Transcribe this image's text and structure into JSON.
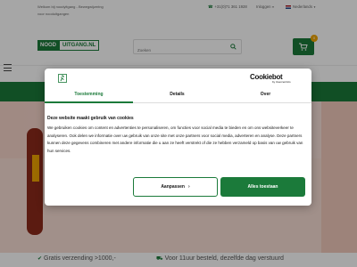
{
  "topbar": {
    "welcome": "Welkom bij noodуitgang - Bewegwijzering voor nooduitgangen",
    "phone": "+31(0)71 361 1928",
    "login": "Inloggen",
    "language": "Nederlands"
  },
  "header": {
    "logo_part1": "NOOD",
    "logo_part2": "UITGANG.NL",
    "search_placeholder": "Zoeken",
    "cart_count": "0"
  },
  "cookie_dialog": {
    "brand": "Cookiebot",
    "brand_sub": "by Usercentrics",
    "tabs": [
      {
        "label": "Toestemming"
      },
      {
        "label": "Details"
      },
      {
        "label": "Over"
      }
    ],
    "title": "Deze website maakt gebruik van cookies",
    "body": "We gebruiken cookies om content en advertenties te personaliseren, om functies voor social media te bieden en om ons websiteverkeer te analyseren. Ook delen we informatie over uw gebruik van onze site met onze partners voor social media, adverteren en analyse. Deze partners kunnen deze gegevens combineren met andere informatie die u aan ze heeft verstrekt of die ze hebben verzameld op basis van uw gebruik van hun services.",
    "customize_label": "Aanpassen",
    "allow_all_label": "Alles toestaan"
  },
  "usp": {
    "item1": "Gratis verzending >1000,-",
    "item2": "Voor 11uur besteld, dezelfde dag verstuurd"
  },
  "colors": {
    "brand_green": "#1b7a3a",
    "badge_orange": "#f0a500"
  }
}
